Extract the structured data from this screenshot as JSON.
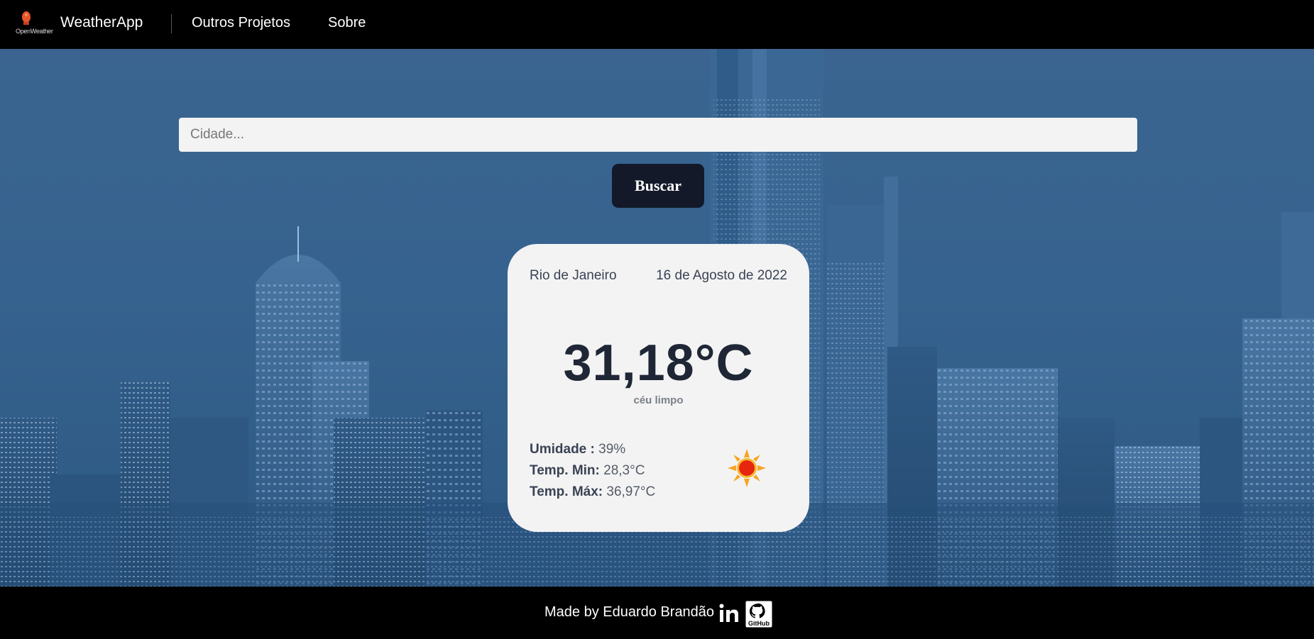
{
  "header": {
    "logo_text": "OpenWeather",
    "brand": "WeatherApp",
    "nav": [
      {
        "label": "Outros Projetos"
      },
      {
        "label": "Sobre"
      }
    ]
  },
  "search": {
    "placeholder": "Cidade...",
    "value": "",
    "button_label": "Buscar"
  },
  "weather": {
    "city": "Rio de Janeiro",
    "date": "16 de Agosto de 2022",
    "temperature": "31,18°C",
    "description": "céu limpo",
    "stats": [
      {
        "label": "Umidade :",
        "value": "39%"
      },
      {
        "label": "Temp. Min:",
        "value": "28,3°C"
      },
      {
        "label": "Temp. Máx:",
        "value": "36,97°C"
      }
    ],
    "icon": "sun-icon"
  },
  "footer": {
    "text": "Made by Eduardo Brandão",
    "links": [
      {
        "icon": "linkedin-icon",
        "text": "in"
      },
      {
        "icon": "github-icon",
        "text": "GitHub"
      }
    ]
  },
  "colors": {
    "background_blue": "#36628f",
    "button_dark": "#131929",
    "card_bg": "#f3f3f3"
  }
}
